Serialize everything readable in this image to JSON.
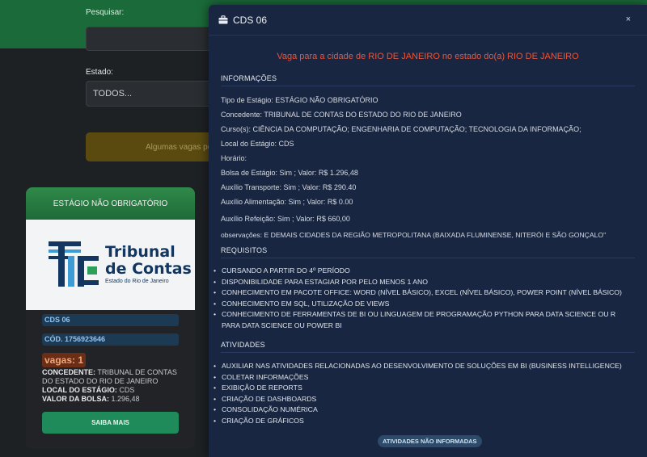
{
  "background": {
    "search_label": "Pesquisar:",
    "estado_label": "Estado:",
    "estado_value": "TODOS...",
    "alert_text": "Algumas vagas po"
  },
  "card": {
    "header": "ESTÁGIO NÃO OBRIGATÓRIO",
    "logo": {
      "line1": "Tribunal",
      "line2": "de Contas",
      "line3": "Estado do Rio de Janeiro"
    },
    "code": "CDS 06",
    "cod": "CÓD. 1756923646",
    "vagas": "vagas: 1",
    "concedente_label": "CONCEDENTE:",
    "concedente_value": " TRIBUNAL DE CONTAS DO ESTADO DO RIO DE JANEIRO",
    "local_label": "LOCAL DO ESTÁGIO:",
    "local_value": " CDS",
    "bolsa_label": "VALOR DA BOLSA:",
    "bolsa_value": " 1.296,48",
    "button": "SAIBA MAIS"
  },
  "modal": {
    "title": "CDS 06",
    "close": "×",
    "headline": "Vaga para a cidade de RIO DE JANEIRO no estado do(a) RIO DE JANEIRO",
    "info_title": "INFORMAÇÕES",
    "rows": {
      "tipo": "Tipo de Estágio: ESTÁGIO NÃO OBRIGATÓRIO",
      "concedente": "Concedente: TRIBUNAL DE CONTAS DO ESTADO DO RIO DE JANEIRO",
      "cursos": "Curso(s): CIÊNCIA DA COMPUTAÇÃO;  ENGENHARIA DE COMPUTAÇÃO;  TECNOLOGIA DA INFORMAÇÃO;",
      "local": "Local do Estágio: CDS",
      "horario": "Horário:",
      "bolsa": "Bolsa de Estágio: Sim ; Valor: R$ 1.296,48",
      "transporte": "Auxílio Transporte: Sim ; Valor: R$ 290.40",
      "alimentacao": "Auxílio Alimentação: Sim ; Valor: R$ 0.00",
      "refeicao": "Auxílio Refeição: Sim ; Valor: R$ 660,00",
      "observacoes": "observações: E DEMAIS CIDADES DA REGIÃO METROPOLITANA (BAIXADA FLUMINENSE, NITERÓI E SÃO GONÇALO\""
    },
    "req_title": "REQUISITOS",
    "requisitos": [
      "CURSANDO A PARTIR DO 4º PERÍODO",
      "DISPONIBILIDADE PARA ESTAGIAR POR PELO MENOS 1 ANO",
      "CONHECIMENTO EM PACOTE OFFICE: WORD (NÍVEL BÁSICO), EXCEL (NÍVEL BÁSICO), POWER POINT (NÍVEL BÁSICO)",
      "CONHECIMENTO EM SQL, UTILIZAÇÃO DE VIEWS",
      "CONHECIMENTO DE FERRAMENTAS DE BI OU LINGUAGEM DE PROGRAMAÇÃO PYTHON PARA DATA SCIENCE OU R PARA DATA SCIENCE OU POWER BI"
    ],
    "ativ_title": "ATIVIDADES",
    "atividades": [
      "AUXILIAR NAS ATIVIDADES RELACIONADAS AO DESENVOLVIMENTO DE SOLUÇÕES EM BI (BUSINESS INTELLIGENCE)",
      "COLETAR INFORMAÇÕES",
      "EXIBIÇÃO DE REPORTS",
      "CRIAÇÃO DE DASHBOARDS",
      "CONSOLIDAÇÃO NUMÉRICA",
      "CRIAÇÃO DE GRÁFICOS"
    ],
    "pill": "ATIVIDADES NÃO INFORMADAS"
  },
  "colors": {
    "modal_bg": "#182642",
    "headline": "#e8563a",
    "card_header": "#2f8a4a",
    "button": "#1f8a5a",
    "vagas_badge": "#6a2d16"
  }
}
